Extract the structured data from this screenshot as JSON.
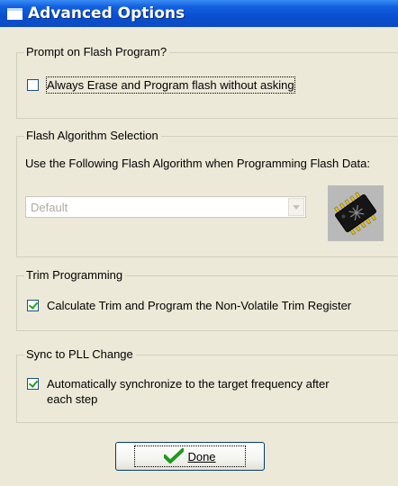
{
  "dialog": {
    "title": "Advanced Options"
  },
  "prompt_group": {
    "legend": "Prompt on Flash Program?",
    "checkbox_label": "Always Erase and Program flash without asking",
    "checked": false
  },
  "algorithm_group": {
    "legend": "Flash Algorithm Selection",
    "instruction": "Use the Following Flash Algorithm when Programming Flash Data:",
    "select_value": "Default"
  },
  "trim_group": {
    "legend": "Trim Programming",
    "checkbox_label": "Calculate Trim and Program the Non-Volatile Trim Register",
    "checked": true
  },
  "sync_group": {
    "legend": "Sync to PLL Change",
    "checkbox_label_line1": "Automatically synchronize to the target frequency after",
    "checkbox_label_line2": "each step",
    "checked": true
  },
  "done_button": {
    "label": "Done"
  },
  "icons": {
    "window": "window-icon",
    "dropdown": "chevron-down-icon",
    "chip": "microchip-icon",
    "checkmark": "checkmark-icon"
  },
  "colors": {
    "titlebar": "#0a4fd0",
    "dialog_bg": "#ece9d8",
    "check_green": "#21a121"
  }
}
